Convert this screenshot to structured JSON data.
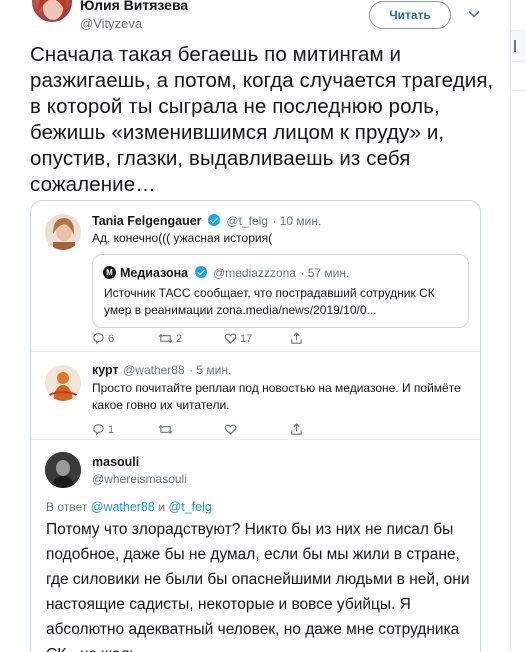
{
  "header": {
    "author_name": "Юлия Витязева",
    "author_handle": "@Vityzeva",
    "follow_label": "Читать"
  },
  "main_tweet": {
    "text": "Сначала такая бегаешь по митингам и разжигаешь, а потом, когда случается трагедия, в которой ты сыграла не последнюю роль, бежишь «изменившимся лицом к пруду» и, опустив, глазки, выдавливаешь из себя сожаление…"
  },
  "thread": {
    "reply1": {
      "name": "Tania Felgengauer",
      "handle": "@t_felg",
      "time": "· 10 мин.",
      "text": "Ад, конечно((( ужасная история(",
      "quote": {
        "logo_letter": "M",
        "name": "Медиазона",
        "handle": "@mediazzzona",
        "time": "· 57 мин.",
        "text": "Источник ТАСС сообщает, что пострадавший сотрудник СК умер в реанимации zona.media/news/2019/10/0..."
      },
      "counts": {
        "replies": "6",
        "retweets": "2",
        "likes": "17"
      }
    },
    "reply2": {
      "name": "курт",
      "handle": "@wather88",
      "time": "· 5 мин.",
      "text": "Просто почитайте реплаи под новостью на медиазоне. И поймёте какое говно их читатели.",
      "counts": {
        "replies": "1"
      }
    },
    "reply3": {
      "name": "masouli",
      "handle": "@whereismasouli",
      "reply_to_prefix": "В ответ",
      "reply_to_user1": "@wather88",
      "reply_to_and": "и",
      "reply_to_user2": "@t_felg",
      "text": "Потому что злорадствуют? Никто бы из них не писал бы подобное, даже бы не думал, если бы мы жили в стране, где силовики не были бы опаснейшими людьми в ней, они настоящие садисты, некоторые и вовсе убийцы. Я абсолютно адекватный человек, но даже мне сотрудника СК - не жаль."
    }
  },
  "icons": [
    "reply-icon",
    "retweet-icon",
    "like-icon",
    "share-icon",
    "chevron-down-icon",
    "verified-icon"
  ],
  "colors": {
    "link": "#1b95e0",
    "verified": "#1da1f2",
    "follow_text": "#1b6ea8",
    "muted": "#657786"
  }
}
